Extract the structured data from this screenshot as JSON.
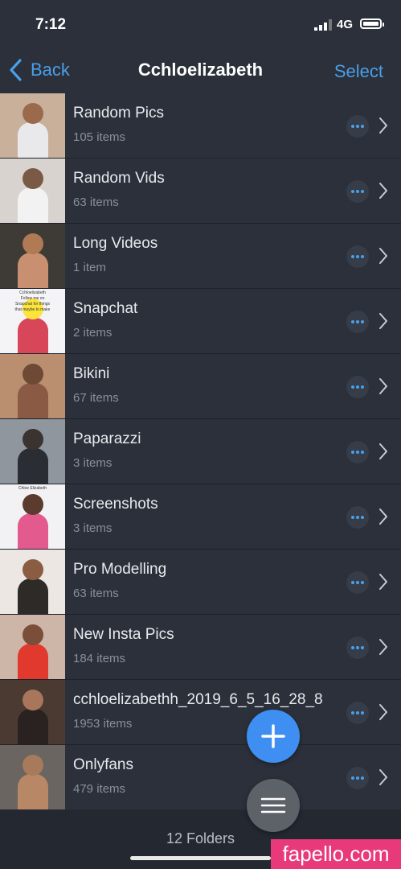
{
  "status": {
    "time": "7:12",
    "network": "4G"
  },
  "nav": {
    "back_label": "Back",
    "title": "Cchloelizabeth",
    "select_label": "Select"
  },
  "folders": [
    {
      "name": "Random Pics",
      "count": "105 items",
      "thumb_bg": "#c9b09a",
      "thumb_fig": "#9b6a4d",
      "thumb_body": "#e9e9ec"
    },
    {
      "name": "Random Vids",
      "count": "63 items",
      "thumb_bg": "#d9d3d0",
      "thumb_fig": "#7b5a45",
      "thumb_body": "#f2f2f2"
    },
    {
      "name": "Long Videos",
      "count": "1 item",
      "thumb_bg": "#3e3a36",
      "thumb_fig": "#b07a55",
      "thumb_body": "#c89070"
    },
    {
      "name": "Snapchat",
      "count": "2 items",
      "thumb_bg": "#f4f4f6",
      "thumb_fig": "#fbe43c",
      "thumb_body": "#d8465a",
      "thumb_text": [
        "Cchloelizabeth",
        "Follow me on",
        "Snapchat for things",
        "that maybe to make"
      ]
    },
    {
      "name": "Bikini",
      "count": "67 items",
      "thumb_bg": "#b98f6f",
      "thumb_fig": "#6e4a36",
      "thumb_body": "#8a5a45"
    },
    {
      "name": "Paparazzi",
      "count": "3 items",
      "thumb_bg": "#8f969e",
      "thumb_fig": "#3a3330",
      "thumb_body": "#2a2d33"
    },
    {
      "name": "Screenshots",
      "count": "3 items",
      "thumb_bg": "#f2f2f4",
      "thumb_fig": "#5a3b2e",
      "thumb_body": "#e25a8e",
      "thumb_text": [
        "Chloe Elizabeth"
      ]
    },
    {
      "name": "Pro Modelling",
      "count": "63 items",
      "thumb_bg": "#ece7e2",
      "thumb_fig": "#8a5c42",
      "thumb_body": "#2e2a28"
    },
    {
      "name": "New Insta Pics",
      "count": "184 items",
      "thumb_bg": "#cdb6a7",
      "thumb_fig": "#7a4e38",
      "thumb_body": "#e2392f"
    },
    {
      "name": "cchloelizabethh_2019_6_5_16_28_8",
      "count": "1953 items",
      "thumb_bg": "#4a3a32",
      "thumb_fig": "#a8765a",
      "thumb_body": "#2a2220"
    },
    {
      "name": "Onlyfans",
      "count": "479 items",
      "thumb_bg": "#6a6560",
      "thumb_fig": "#a77a5c",
      "thumb_body": "#b88866"
    }
  ],
  "footer": {
    "folder_count": "12 Folders"
  },
  "watermark": "fapello.com",
  "colors": {
    "accent": "#4a9fe8",
    "fab": "#3f8ef1",
    "background": "#2b303a"
  }
}
